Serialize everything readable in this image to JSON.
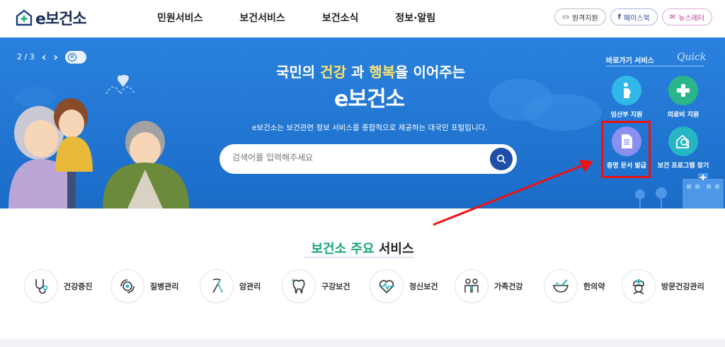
{
  "header": {
    "logo_text": "e보건소",
    "nav": [
      "민원서비스",
      "보건서비스",
      "보건소식",
      "정보·알림"
    ],
    "util_buttons": [
      {
        "label": "원격지원",
        "icon": "monitor-icon"
      },
      {
        "label": "페이스북",
        "icon": "facebook-icon"
      },
      {
        "label": "뉴스레터",
        "icon": "newsletter-icon"
      }
    ]
  },
  "hero": {
    "pager": {
      "current": "2",
      "separator": "/",
      "total": "3"
    },
    "title_part1": "국민의 ",
    "title_hl1": "건강",
    "title_part2": " 과 ",
    "title_hl2": "행복",
    "title_part3": "을 이어주는",
    "title_main": "e보건소",
    "description": "e보건소는 보건관련 정보 서비스를 종합적으로 제공하는 대국민 포털입니다.",
    "search": {
      "placeholder": "검색어를 입력해주세요"
    }
  },
  "quick": {
    "label": "바로가기 서비스",
    "label_en": "Quick",
    "items": [
      {
        "label": "임산부 지원",
        "icon": "pregnant-icon",
        "color": "#2fb8e8"
      },
      {
        "label": "의료비 지원",
        "icon": "medical-cross-icon",
        "color": "#2bb58a"
      },
      {
        "label": "증명 문서 발급",
        "icon": "document-icon",
        "color": "#8a8ff0"
      },
      {
        "label": "보건 프로그램 찾기",
        "icon": "program-search-icon",
        "color": "#26b5c4"
      }
    ]
  },
  "services": {
    "title_green": "보건소 주요",
    "title_rest": " 서비스",
    "items": [
      {
        "label": "건강증진",
        "icon": "stethoscope-icon"
      },
      {
        "label": "질병관리",
        "icon": "virus-icon"
      },
      {
        "label": "암관리",
        "icon": "ribbon-icon"
      },
      {
        "label": "구강보건",
        "icon": "tooth-icon"
      },
      {
        "label": "정신보건",
        "icon": "heartbeat-icon"
      },
      {
        "label": "가족건강",
        "icon": "family-icon"
      },
      {
        "label": "한의약",
        "icon": "mortar-icon"
      },
      {
        "label": "방문건강관리",
        "icon": "nurse-icon"
      }
    ]
  },
  "colors": {
    "hero_bg": "#1f74cf",
    "accent_green": "#1aa37a",
    "highlight_red": "#e11111"
  }
}
